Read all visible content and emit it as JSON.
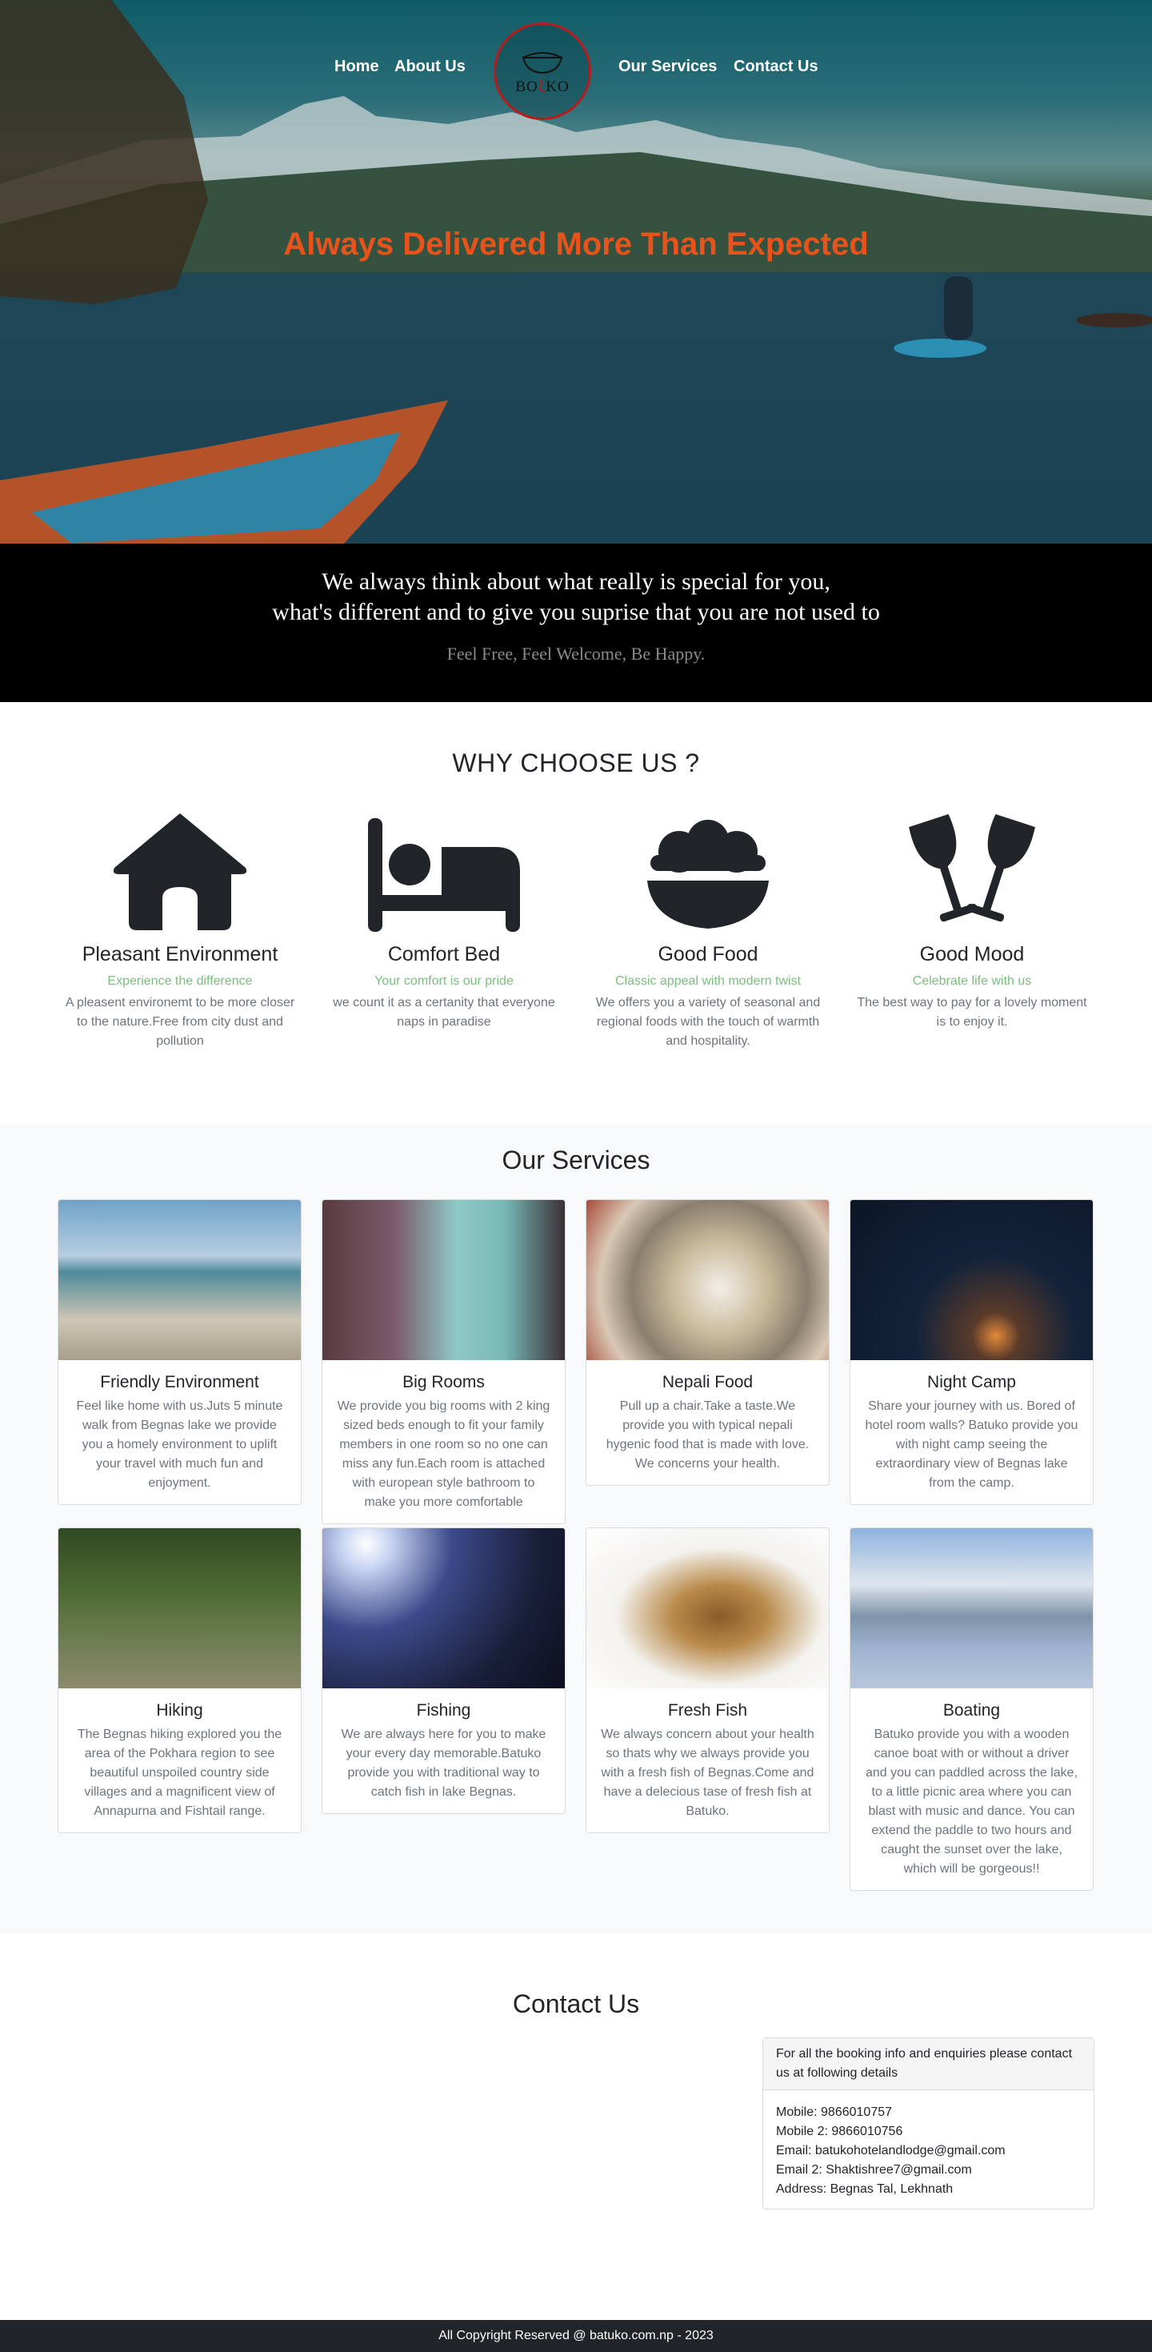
{
  "nav": {
    "home": "Home",
    "about": "About Us",
    "services": "Our Services",
    "contact": "Contact Us",
    "logo_left": "BO",
    "logo_mid": "ξ",
    "logo_right": "KO"
  },
  "hero": {
    "title": "Always Delivered More Than Expected"
  },
  "band": {
    "line1": "We always think about what really is special for you,",
    "line2": "what's different and to give you suprise that you are not used to",
    "sub": "Feel Free, Feel Welcome, Be Happy."
  },
  "why": {
    "title": "WHY CHOOSE US ?",
    "features": [
      {
        "icon": "house-icon",
        "title": "Pleasant Environment",
        "tag": "Experience the difference",
        "text": "A pleasent environemt to be more closer to the nature.Free from city dust and pollution"
      },
      {
        "icon": "bed-icon",
        "title": "Comfort Bed",
        "tag": "Your comfort is our pride",
        "text": "we count it as a certanity that everyone naps in paradise"
      },
      {
        "icon": "bowl-food-icon",
        "title": "Good Food",
        "tag": "Classic appeal with modern twist",
        "text": "We offers you a variety of seasonal and regional foods with the touch of warmth and hospitality."
      },
      {
        "icon": "glasses-cheers-icon",
        "title": "Good Mood",
        "tag": "Celebrate life with us",
        "text": "The best way to pay for a lovely moment is to enjoy it."
      }
    ]
  },
  "services": {
    "title": "Our Services",
    "cards": [
      {
        "title": "Friendly Environment",
        "text": "Feel like home with us.Juts 5 minute walk from Begnas lake we provide you a homely environment to uplift your travel with much fun and enjoyment."
      },
      {
        "title": "Big Rooms",
        "text": "We provide you big rooms with 2 king sized beds enough to fit your family members in one room so no one can miss any fun.Each room is attached with european style bathroom to make you more comfortable"
      },
      {
        "title": "Nepali Food",
        "text": "Pull up a chair.Take a taste.We provide you with typical nepali hygenic food that is made with love. We concerns your health."
      },
      {
        "title": "Night Camp",
        "text": "Share your journey with us. Bored of hotel room walls? Batuko provide you with night camp seeing the extraordinary view of Begnas lake from the camp."
      },
      {
        "title": "Hiking",
        "text": "The Begnas hiking explored you the area of the Pokhara region to see beautiful unspoiled country side villages and a magnificent view of Annapurna and Fishtail range."
      },
      {
        "title": "Fishing",
        "text": "We are always here for you to make your every day memorable.Batuko provide you with traditional way to catch fish in lake Begnas."
      },
      {
        "title": "Fresh Fish",
        "text": "We always concern about your health so thats why we always provide you with a fresh fish of Begnas.Come and have a delecious tase of fresh fish at Batuko."
      },
      {
        "title": "Boating",
        "text": "Batuko provide you with a wooden canoe boat with or without a driver and you can paddled across the lake, to a little picnic area where you can blast with music and dance. You can extend the paddle to two hours and caught the sunset over the lake, which will be gorgeous!!"
      }
    ]
  },
  "contact": {
    "title": "Contact Us",
    "header": "For all the booking info and enquiries please contact us at following details",
    "lines": [
      "Mobile: 9866010757",
      "Mobile 2: 9866010756",
      "Email: batukohotelandlodge@gmail.com",
      "Email 2: Shaktishree7@gmail.com",
      "Address: Begnas Tal, Lekhnath"
    ]
  },
  "footer": {
    "text": "All Copyright Reserved @ batuko.com.np - 2023"
  }
}
